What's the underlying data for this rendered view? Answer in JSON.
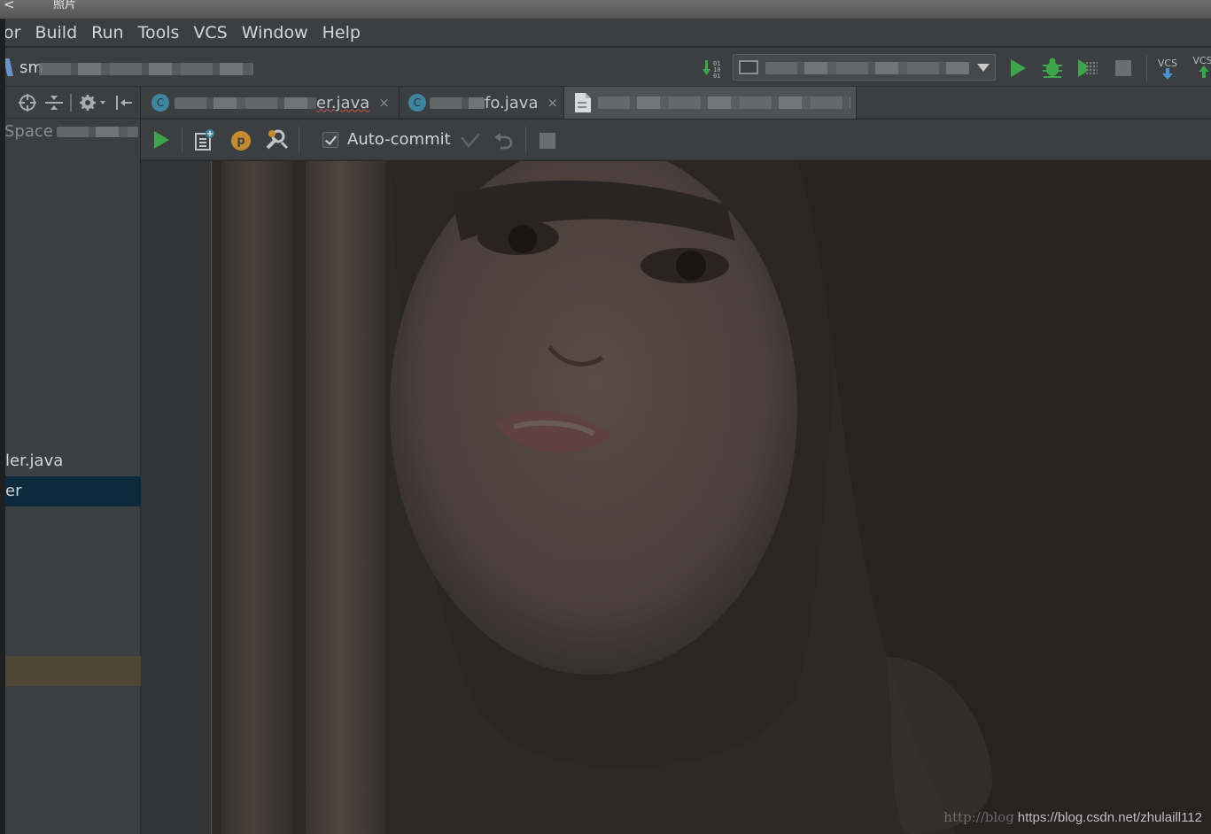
{
  "window": {
    "back_glyph": "<",
    "title": "照片"
  },
  "menu": [
    "or",
    "Build",
    "Run",
    "Tools",
    "VCS",
    "Window",
    "Help"
  ],
  "toolbar": {
    "project_name": "sm",
    "vcs_update_label": "VCS",
    "vcs_commit_label": "VCS"
  },
  "left_panel": {
    "space_label": "Space",
    "items": [
      {
        "label": "ler.java",
        "state": "normal"
      },
      {
        "label": "er",
        "state": "selected"
      },
      {
        "label": "",
        "state": "highlighted"
      }
    ]
  },
  "tabs": [
    {
      "icon_letter": "C",
      "label": "er.java",
      "close": "×"
    },
    {
      "icon_letter": "C",
      "label": "fo.java",
      "close": "×"
    },
    {
      "icon_letter": "",
      "label": "",
      "close": ""
    }
  ],
  "db_toolbar": {
    "autocommit_label": "Auto-commit",
    "autocommit_checked": true,
    "profile_badge": "p"
  },
  "watermark": {
    "ghost": "http://blog",
    "text": "https://blog.csdn.net/zhulaill112"
  },
  "colors": {
    "run_green": "#3fa54a",
    "selection_blue": "#0d293e",
    "class_icon": "#3e86a0",
    "badge_orange": "#c58a2f"
  }
}
